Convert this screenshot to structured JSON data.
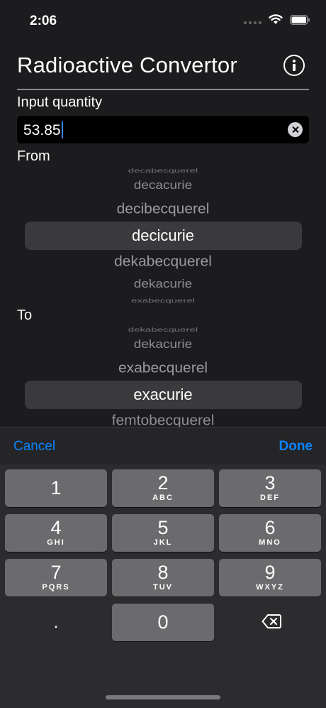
{
  "status_bar": {
    "time": "2:06",
    "icons": [
      "signal-icon",
      "wifi-icon",
      "battery-icon"
    ]
  },
  "header": {
    "title": "Radioactive Convertor",
    "info_icon": "info-icon"
  },
  "input": {
    "label": "Input quantity",
    "value": "53.85"
  },
  "from_picker": {
    "label": "From",
    "rows": [
      "decabecquerel",
      "decacurie",
      "decibecquerel",
      "decicurie",
      "dekabecquerel",
      "dekacurie",
      "exabecquerel"
    ],
    "selected": "decicurie"
  },
  "to_picker": {
    "label": "To",
    "rows": [
      "dekabecquerel",
      "dekacurie",
      "exabecquerel",
      "exacurie",
      "femtobecquerel"
    ],
    "selected": "exacurie"
  },
  "keyboard": {
    "toolbar": {
      "cancel": "Cancel",
      "done": "Done"
    },
    "keys": [
      {
        "digit": "1",
        "letters": ""
      },
      {
        "digit": "2",
        "letters": "ABC"
      },
      {
        "digit": "3",
        "letters": "DEF"
      },
      {
        "digit": "4",
        "letters": "GHI"
      },
      {
        "digit": "5",
        "letters": "JKL"
      },
      {
        "digit": "6",
        "letters": "MNO"
      },
      {
        "digit": "7",
        "letters": "PQRS"
      },
      {
        "digit": "8",
        "letters": "TUV"
      },
      {
        "digit": "9",
        "letters": "WXYZ"
      },
      {
        "digit": ".",
        "letters": ""
      },
      {
        "digit": "0",
        "letters": ""
      },
      {
        "digit": "",
        "letters": "",
        "icon": "backspace-icon"
      }
    ]
  },
  "colors": {
    "background": "#1c1c1e",
    "accent": "#0a84ff",
    "key": "#6b6b6e"
  }
}
